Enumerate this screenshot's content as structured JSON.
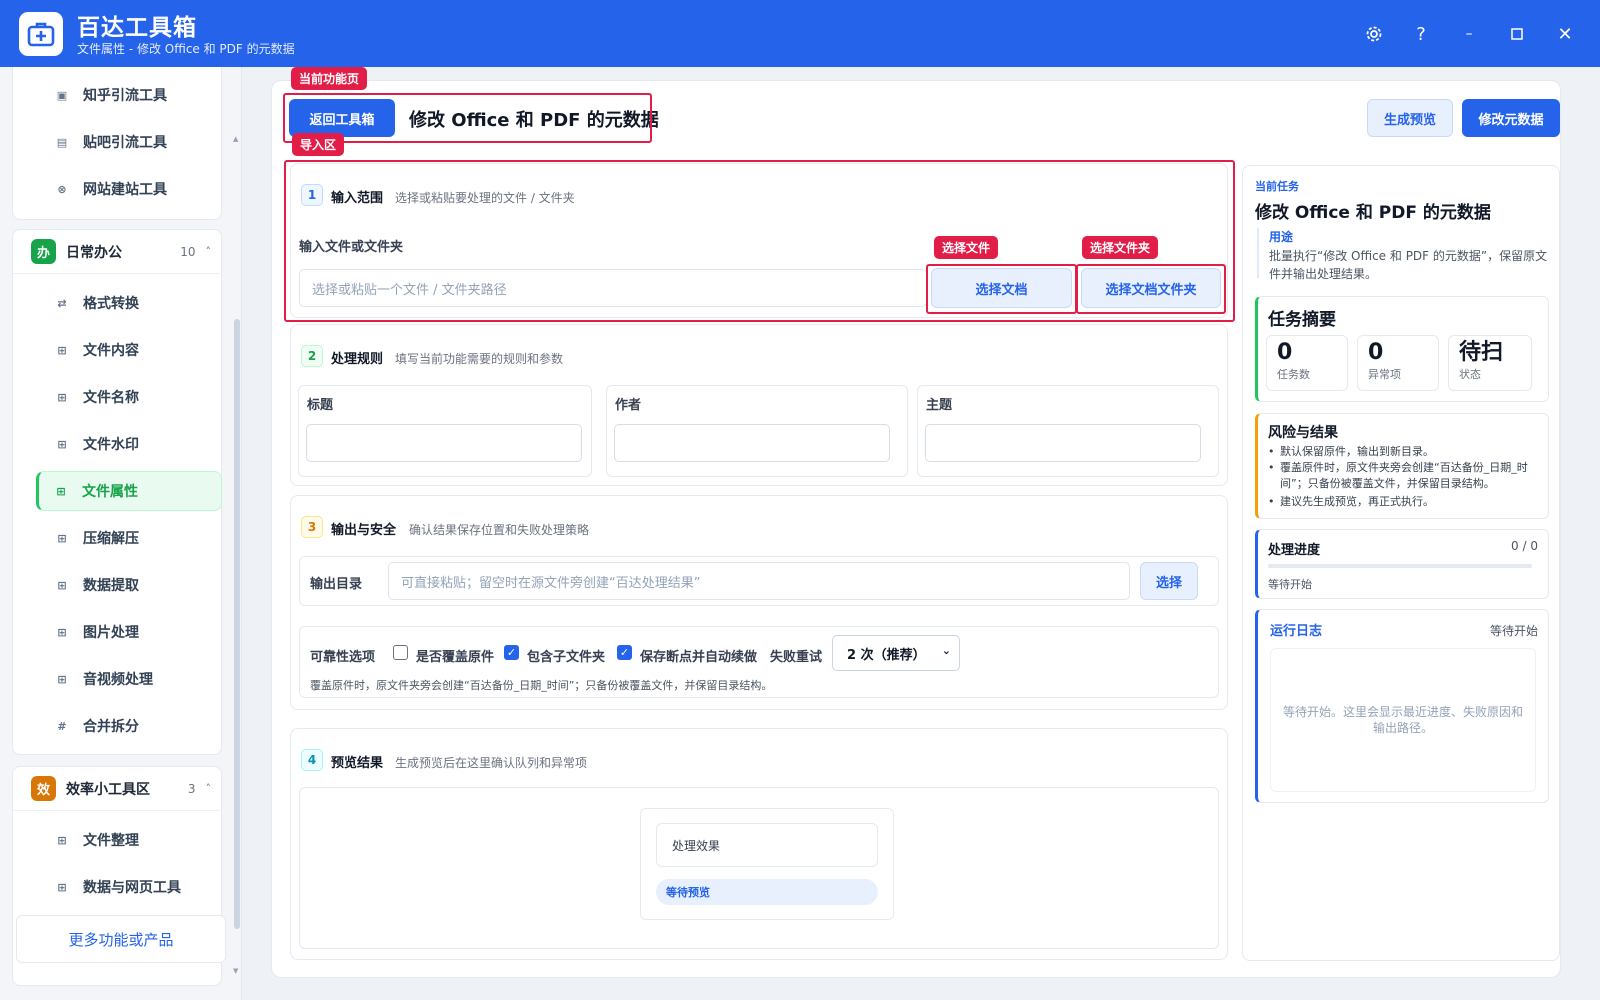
{
  "app": {
    "name": "百达工具箱",
    "subtitle": "文件属性 - 修改 Office 和 PDF 的元数据",
    "window_icons": [
      "gear-icon",
      "help-icon",
      "minimize-icon",
      "maximize-icon",
      "close-icon"
    ]
  },
  "sidebar": {
    "group_top_items": [
      {
        "label": "知乎引流工具",
        "icon": "square-icon"
      },
      {
        "label": "贴吧引流工具",
        "icon": "square-icon"
      },
      {
        "label": "网站建站工具",
        "icon": "circle-icon"
      }
    ],
    "group_daily": {
      "badge": "办",
      "title": "日常办公",
      "count": "10",
      "items": [
        {
          "label": "格式转换",
          "icon": "swap-icon"
        },
        {
          "label": "文件内容",
          "icon": "grid-icon"
        },
        {
          "label": "文件名称",
          "icon": "grid-icon"
        },
        {
          "label": "文件水印",
          "icon": "grid-icon"
        },
        {
          "label": "文件属性",
          "icon": "grid-icon",
          "active": true
        },
        {
          "label": "压缩解压",
          "icon": "grid-icon"
        },
        {
          "label": "数据提取",
          "icon": "grid-icon"
        },
        {
          "label": "图片处理",
          "icon": "grid-icon"
        },
        {
          "label": "音视频处理",
          "icon": "grid-icon"
        },
        {
          "label": "合并拆分",
          "icon": "hash-icon"
        }
      ]
    },
    "group_efficiency": {
      "badge": "效",
      "title": "效率小工具区",
      "count": "3",
      "items": [
        {
          "label": "文件整理",
          "icon": "grid-icon"
        },
        {
          "label": "数据与网页工具",
          "icon": "grid-icon"
        }
      ]
    },
    "more_label": "更多功能或产品"
  },
  "annotations": {
    "current_page": "当前功能页",
    "import_area": "导入区",
    "select_file": "选择文件",
    "select_folder": "选择文件夹"
  },
  "header": {
    "back_label": "返回工具箱",
    "title": "修改 Office 和 PDF 的元数据",
    "preview_label": "生成预览",
    "run_label": "修改元数据"
  },
  "section1": {
    "num": "1",
    "title": "输入范围",
    "subtitle": "选择或粘贴要处理的文件 / 文件夹",
    "field_label": "输入文件或文件夹",
    "placeholder": "选择或粘贴一个文件 / 文件夹路径",
    "choose_file_label": "选择文档",
    "choose_folder_label": "选择文档文件夹"
  },
  "section2": {
    "num": "2",
    "title": "处理规则",
    "subtitle": "填写当前功能需要的规则和参数",
    "fields": [
      {
        "label": "标题",
        "value": ""
      },
      {
        "label": "作者",
        "value": ""
      },
      {
        "label": "主题",
        "value": ""
      }
    ]
  },
  "section3": {
    "num": "3",
    "title": "输出与安全",
    "subtitle": "确认结果保存位置和失败处理策略",
    "output_label": "输出目录",
    "output_placeholder": "可直接粘贴；留空时在源文件旁创建“百达处理结果”",
    "choose_label": "选择",
    "options_label": "可靠性选项",
    "overwrite_label": "是否覆盖原件",
    "overwrite_checked": false,
    "subfolder_label": "包含子文件夹",
    "subfolder_checked": true,
    "resume_label": "保存断点并自动续做",
    "resume_checked": true,
    "retry_label": "失败重试",
    "retry_value": "2 次（推荐）",
    "note": "覆盖原件时，原文件夹旁会创建“百达备份_日期_时间”；只备份被覆盖文件，并保留目录结构。"
  },
  "section4": {
    "num": "4",
    "title": "预览结果",
    "subtitle": "生成预览后在这里确认队列和异常项",
    "effect_label": "处理效果",
    "status_pill": "等待预览"
  },
  "right_panel": {
    "current_task_label": "当前任务",
    "task_title": "修改 Office 和 PDF 的元数据",
    "usage_label": "用途",
    "usage_text": "批量执行“修改 Office 和 PDF 的元数据”，保留原文件并输出处理结果。",
    "summary_title": "任务摘要",
    "stats": [
      {
        "value": "0",
        "label": "任务数"
      },
      {
        "value": "0",
        "label": "异常项"
      },
      {
        "value": "待扫",
        "label": "状态"
      }
    ],
    "risk_title": "风险与结果",
    "risk_items": [
      "默认保留原件，输出到新目录。",
      "覆盖原件时，原文件夹旁会创建“百达备份_日期_时间”；只备份被覆盖文件，并保留目录结构。",
      "建议先生成预览，再正式执行。"
    ],
    "progress_title": "处理进度",
    "progress_count": "0 / 0",
    "progress_fraction": 0,
    "progress_status": "等待开始",
    "log_title": "运行日志",
    "log_status": "等待开始",
    "log_empty": "等待开始。这里会显示最近进度、失败原因和输出路径。"
  },
  "colors": {
    "primary": "#2563eb",
    "accent_green": "#22c55e",
    "annotation_red": "#e11d48",
    "badge_daily": "#16a34a",
    "badge_efficiency": "#d97706"
  }
}
